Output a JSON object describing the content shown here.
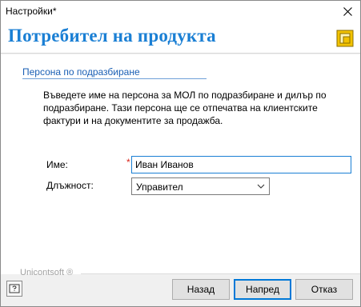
{
  "window": {
    "title": "Настройки*"
  },
  "header": {
    "title": "Потребител на продукта",
    "logo_icon": "app-logo-icon"
  },
  "section": {
    "title": "Персона по подразбиране",
    "description": "Въведете име на персона за МОЛ по подразбиране и дилър по подразбиране. Тази персона ще се отпечатва на клиентските фактури и на документите за продажба."
  },
  "form": {
    "name_label": "Име:",
    "required_mark": "*",
    "name_value": "Иван Иванов",
    "position_label": "Длъжност:",
    "position_value": "Управител"
  },
  "footer": {
    "brand": "Unicontsoft ®",
    "back_label": "Назад",
    "next_label": "Напред",
    "cancel_label": "Отказ"
  },
  "colors": {
    "accent": "#1a7fd4",
    "required": "#d9261c",
    "default_button_border": "#0078d7"
  }
}
